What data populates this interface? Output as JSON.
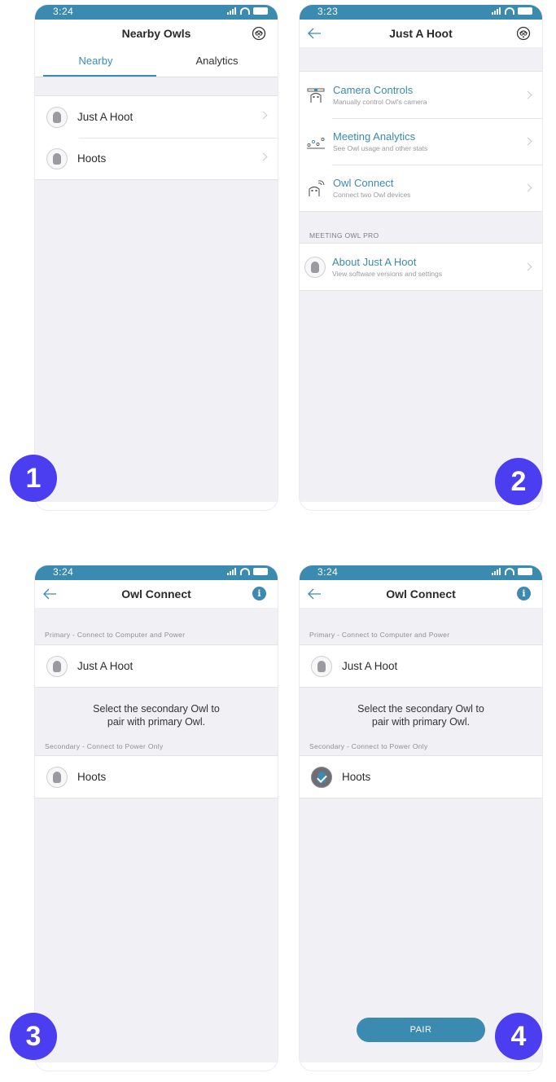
{
  "colors": {
    "accent": "#3b8bb0",
    "step_badge": "#4b3df0",
    "background": "#f1f1f5"
  },
  "screen1": {
    "time": "3:24",
    "title": "Nearby Owls",
    "support_icon": "owl-support-icon",
    "tabs": [
      {
        "label": "Nearby",
        "active": true
      },
      {
        "label": "Analytics",
        "active": false
      }
    ],
    "owls": [
      {
        "name": "Just A Hoot"
      },
      {
        "name": "Hoots"
      }
    ],
    "step": "1"
  },
  "screen2": {
    "time": "3:23",
    "title": "Just A Hoot",
    "menu": [
      {
        "title": "Camera Controls",
        "subtitle": "Manually control Owl's camera",
        "icon": "camera-controls-icon"
      },
      {
        "title": "Meeting Analytics",
        "subtitle": "See Owl usage and other stats",
        "icon": "analytics-icon"
      },
      {
        "title": "Owl Connect",
        "subtitle": "Connect two Owl devices",
        "icon": "owl-connect-icon"
      }
    ],
    "section": "MEETING OWL PRO",
    "about": {
      "title": "About Just A Hoot",
      "subtitle": "View software versions and settings"
    },
    "step": "2"
  },
  "screen3": {
    "time": "3:24",
    "title": "Owl Connect",
    "primary_label": "Primary - Connect to Computer and Power",
    "primary_owl": "Just A Hoot",
    "helper_line1": "Select the secondary Owl to",
    "helper_line2": "pair with primary Owl.",
    "secondary_label": "Secondary - Connect to Power Only",
    "secondary_owl": "Hoots",
    "step": "3"
  },
  "screen4": {
    "time": "3:24",
    "title": "Owl Connect",
    "primary_label": "Primary - Connect to Computer and Power",
    "primary_owl": "Just A Hoot",
    "helper_line1": "Select the secondary Owl to",
    "helper_line2": "pair with primary Owl.",
    "secondary_label": "Secondary - Connect to Power Only",
    "secondary_owl": "Hoots",
    "secondary_selected": true,
    "pair_label": "PAIR",
    "step": "4"
  }
}
